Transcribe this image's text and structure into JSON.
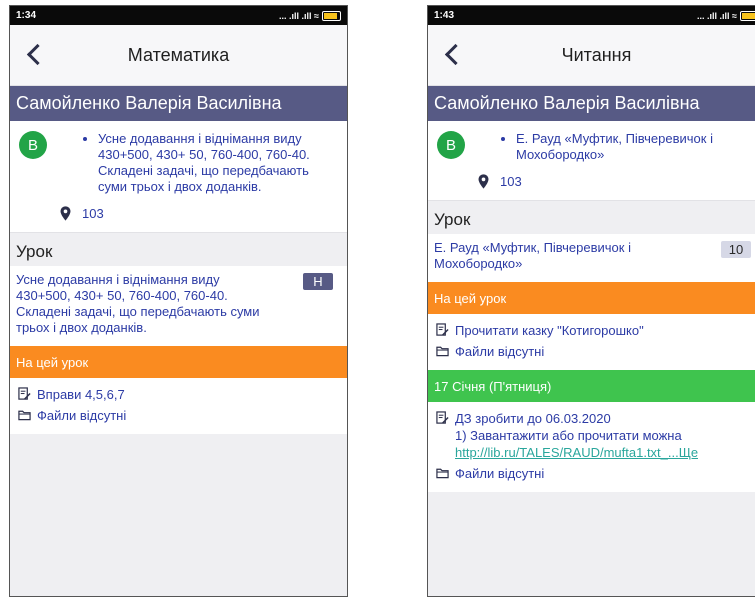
{
  "left": {
    "status": {
      "time": "1:34",
      "icons": "... .ıll .ıll ≈"
    },
    "title": "Математика",
    "student": "Самойленко Валерія Василівна",
    "avatar_letter": "В",
    "topic": "Усне додавання і віднімання виду 430+500, 430+ 50, 760-400, 760-40. Складені задачі, що передбачають суми трьох і двох доданків.",
    "room": "103",
    "lesson_heading": "Урок",
    "lesson_text": "Усне додавання і віднімання виду 430+500, 430+ 50, 760-400, 760-40. Складені задачі, що передбачають суми трьох і двох доданків.",
    "grade": "Н",
    "homework_band": "На цей урок",
    "homework_text": "Вправи 4,5,6,7",
    "files_text": "Файли відсутні"
  },
  "right": {
    "status": {
      "time": "1:43",
      "icons": "... .ıll .ıll ≈"
    },
    "title": "Читання",
    "student": "Самойленко Валерія Василівна",
    "avatar_letter": "В",
    "topic": "Е. Рауд «Муфтик, Півчеревичок і Мохобородко»",
    "room": "103",
    "lesson_heading": "Урок",
    "lesson_text": "Е. Рауд «Муфтик, Півчеревичок і Мохобородко»",
    "grade": "10",
    "homework_band": "На цей урок",
    "homework_text": "Прочитати казку \"Котигорошко\"",
    "files_text": "Файли відсутні",
    "date_band": "17 Січня (П'ятниця)",
    "due_text": "ДЗ зробити до 06.03.2020",
    "due_line2": "1) Завантажити або прочитати можна",
    "due_link": "http://lib.ru/TALES/RAUD/mufta1.txt_...Ще",
    "files_text2": "Файли відсутні"
  },
  "colors": {
    "header": "#575a85",
    "orange": "#fa8b20",
    "green": "#3fc44e",
    "avatar": "#22a447",
    "text": "#2c3ba5"
  }
}
